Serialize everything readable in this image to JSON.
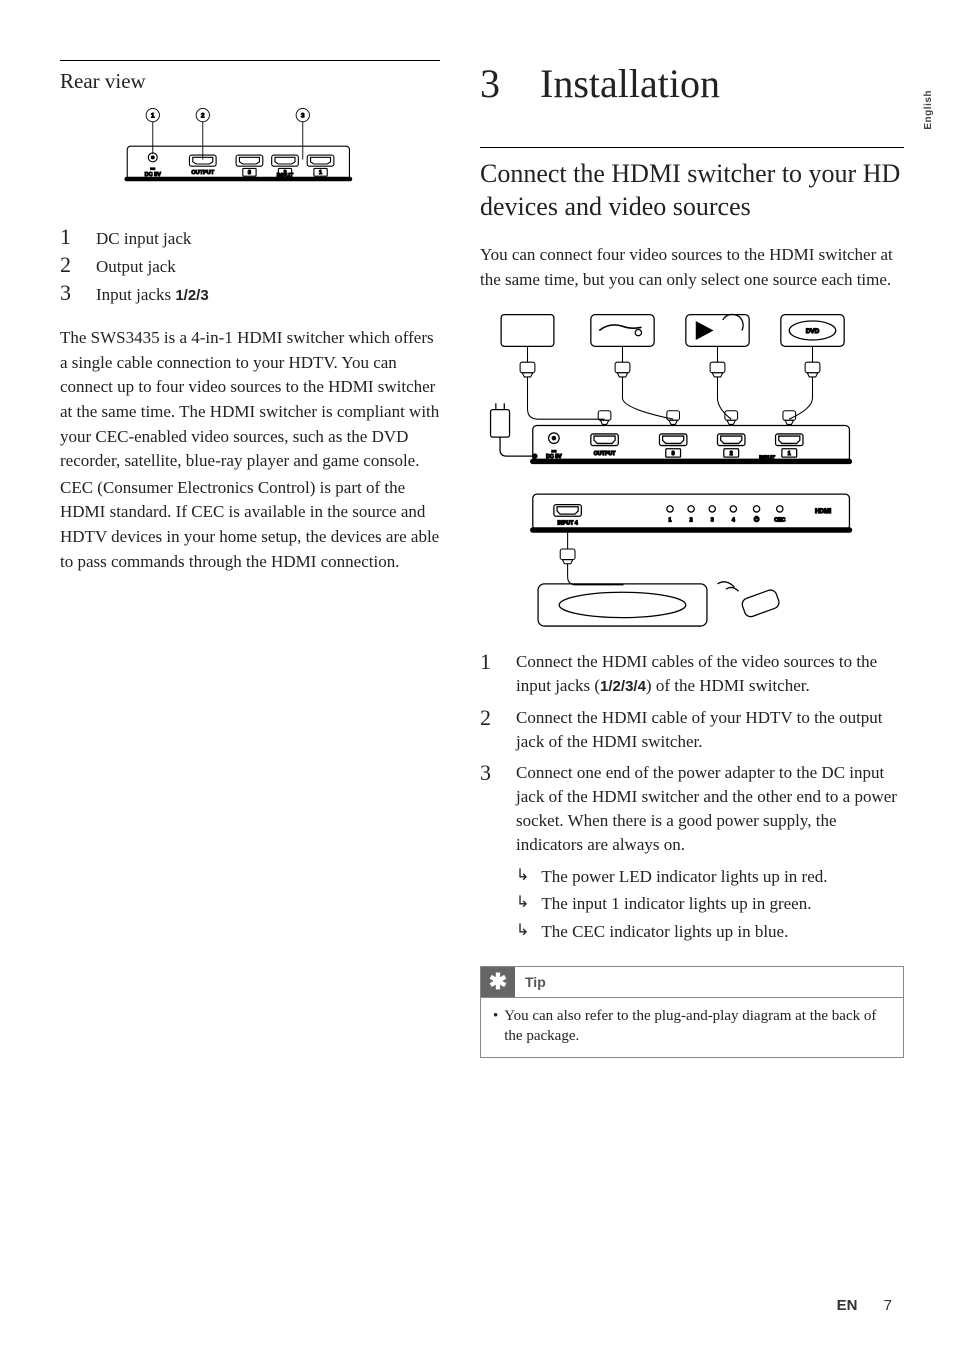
{
  "side_tab": "English",
  "left": {
    "heading": "Rear view",
    "legend": [
      {
        "num": "1",
        "text": "DC input jack"
      },
      {
        "num": "2",
        "text": "Output jack"
      },
      {
        "num": "3",
        "text_prefix": "Input jacks ",
        "bold": "1/2/3"
      }
    ],
    "para1": "The SWS3435 is a 4-in-1 HDMI switcher which offers a single cable connection to your HDTV. You can connect up to four video sources to the HDMI switcher at the same time. The HDMI switcher is compliant with your CEC-enabled video sources, such as the DVD recorder, satellite, blue-ray player and game console.",
    "para2": "CEC (Consumer Electronics Control) is part of the HDMI standard. If CEC is available in the source and HDTV devices in your home setup, the devices are able to pass commands through the HDMI connection."
  },
  "right": {
    "chapter_num": "3",
    "chapter_title": "Installation",
    "sub_heading": "Connect the HDMI switcher to your HD devices and video sources",
    "intro": "You can connect four video sources to the HDMI switcher at the same time, but you can only select one source each time.",
    "steps": [
      {
        "num": "1",
        "parts": [
          "Connect the HDMI cables of the video sources to the input jacks (",
          {
            "bold": "1/2/3/4"
          },
          ") of the HDMI switcher."
        ]
      },
      {
        "num": "2",
        "parts": [
          "Connect the HDMI cable of your HDTV to the output jack of the HDMI switcher."
        ]
      },
      {
        "num": "3",
        "parts": [
          "Connect one end of the power adapter to the DC input jack of the HDMI switcher and the other end to a power socket. When there is a good power supply, the indicators are always on."
        ],
        "subs": [
          "The power LED indicator lights up in red.",
          "The input 1 indicator lights up in green.",
          "The CEC indicator lights up in blue."
        ]
      }
    ],
    "tip": {
      "label": "Tip",
      "body": "You can also refer to the plug-and-play diagram at the back of the package."
    }
  },
  "footer": {
    "lang": "EN",
    "page": "7"
  },
  "diagram_labels": {
    "output": "OUTPUT",
    "input": "INPUT",
    "dc5v": "DC 5V",
    "input4": "INPUT 4",
    "hdmi": "HDMI",
    "cec": "CEC",
    "dvd": "DVD"
  }
}
